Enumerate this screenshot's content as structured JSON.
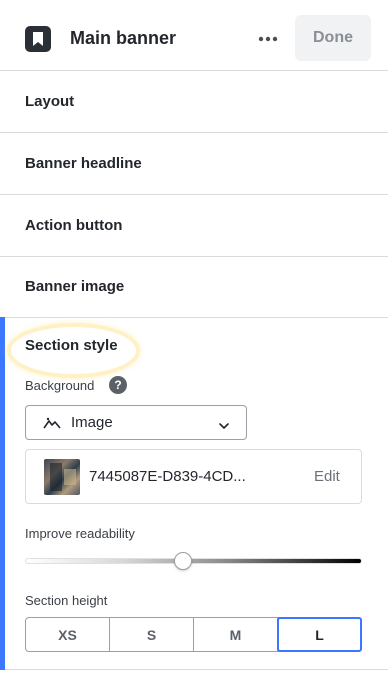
{
  "header": {
    "title": "Main banner",
    "more_icon": "more-horizontal-icon",
    "done_label": "Done"
  },
  "sections": [
    {
      "label": "Layout"
    },
    {
      "label": "Banner headline"
    },
    {
      "label": "Action button"
    },
    {
      "label": "Banner image"
    }
  ],
  "section_style": {
    "heading": "Section style",
    "background_label": "Background",
    "background_select": {
      "value": "Image",
      "icon": "mountains-icon"
    },
    "image": {
      "filename": "7445087E-D839-4CD...",
      "edit_label": "Edit"
    },
    "readability_label": "Improve readability",
    "readability_value": 0.47,
    "height_label": "Section height",
    "height_options": [
      "XS",
      "S",
      "M",
      "L"
    ],
    "height_selected": "L"
  },
  "colors": {
    "accent": "#3b78ff",
    "highlight": "#ffd75a"
  }
}
